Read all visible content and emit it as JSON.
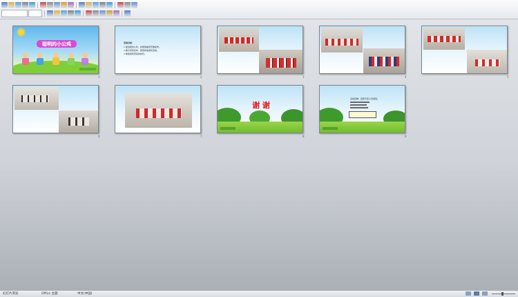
{
  "colors": {
    "accent": "#4a7fc1",
    "grass": "#7cc43a",
    "thanks_red": "#e8151b",
    "title_purple": "#a64bd6"
  },
  "toolbar": {
    "row1_icons": [
      "new-icon",
      "open-icon",
      "save-icon",
      "print-icon",
      "preview-icon",
      "spell-icon",
      "cut-icon",
      "copy-icon",
      "paste-icon",
      "format-painter-icon",
      "undo-icon",
      "redo-icon",
      "table-icon",
      "chart-icon",
      "textbox-icon",
      "picture-icon",
      "zoom-icon",
      "help-icon"
    ],
    "row2_icons": [
      "bold-icon",
      "italic-icon",
      "underline-icon",
      "shadow-icon",
      "align-left-icon",
      "align-center-icon",
      "align-right-icon",
      "bullets-icon",
      "numbering-icon",
      "indent-icon",
      "font-color-icon"
    ]
  },
  "slides": [
    {
      "number": "1",
      "title": "聪明的小公鸡"
    },
    {
      "number": "2",
      "heading": "活动目标：",
      "lines": [
        "1.尝试模仿公鸡，并能随着音乐做动作。",
        "2.能与同伴合作，愿意参加游戏活动。",
        "3.体验游戏带来的快乐。"
      ]
    },
    {
      "number": "3"
    },
    {
      "number": "4"
    },
    {
      "number": "5"
    },
    {
      "number": "6"
    },
    {
      "number": "7"
    },
    {
      "number": "8",
      "title": "谢 谢"
    },
    {
      "number": "9",
      "line": "活动延伸：回家与家人玩游戏。"
    }
  ],
  "status": {
    "slide_position": "幻灯片浏览",
    "theme": "Office 主题",
    "language": "中文(中国)"
  }
}
